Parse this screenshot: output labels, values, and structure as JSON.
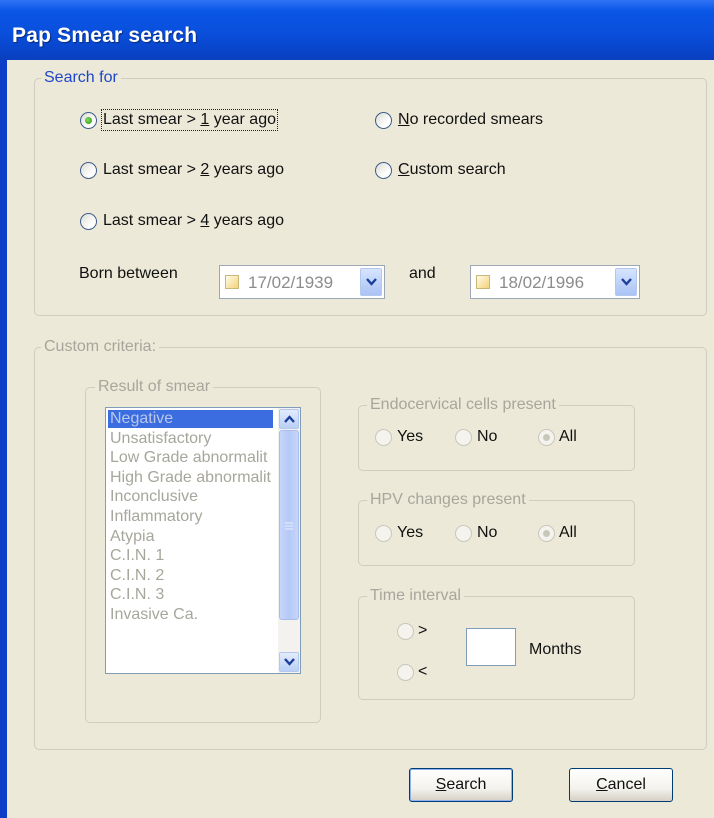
{
  "window": {
    "title": "Pap Smear search"
  },
  "search_for": {
    "legend": "Search for",
    "options": [
      {
        "pre": "Last smear > ",
        "key": "1",
        "post": " year ago",
        "checked": true
      },
      {
        "pre": "Last smear > ",
        "key": "2",
        "post": " years ago",
        "checked": false
      },
      {
        "pre": "Last smear > ",
        "key": "4",
        "post": " years ago",
        "checked": false
      },
      {
        "pre": "",
        "key": "N",
        "post": "o recorded smears",
        "checked": false
      },
      {
        "pre": "",
        "key": "C",
        "post": "ustom search",
        "checked": false
      }
    ],
    "born_between_label": "Born between",
    "date_from": "17/02/1939",
    "and_label": "and",
    "date_to": "18/02/1996"
  },
  "custom_criteria": {
    "legend": "Custom criteria:",
    "result_of_smear": {
      "legend": "Result of smear",
      "items": [
        "Negative",
        "Unsatisfactory",
        "Low Grade abnormalit",
        "High Grade abnormalit",
        "Inconclusive",
        "Inflammatory",
        "Atypia",
        "C.I.N. 1",
        "C.I.N. 2",
        "C.I.N. 3",
        "Invasive Ca."
      ],
      "selected": "Negative"
    },
    "endocervical": {
      "legend": "Endocervical cells present",
      "yes": "Yes",
      "no": "No",
      "all": "All",
      "selected": "All"
    },
    "hpv": {
      "legend": "HPV changes present",
      "yes": "Yes",
      "no": "No",
      "all": "All",
      "selected": "All"
    },
    "time_interval": {
      "legend": "Time interval",
      "greater": ">",
      "less": "<",
      "months_value": "",
      "months_label": "Months"
    }
  },
  "buttons": {
    "search": {
      "key": "S",
      "rest": "earch"
    },
    "cancel": {
      "key": "C",
      "rest": "ancel"
    }
  },
  "colors": {
    "title_bar": "#0a4fdc",
    "dialog_bg": "#ece9d8",
    "legend_text": "#1f46c8",
    "selection": "#3b6de0",
    "disabled_text": "#a7a69c"
  }
}
